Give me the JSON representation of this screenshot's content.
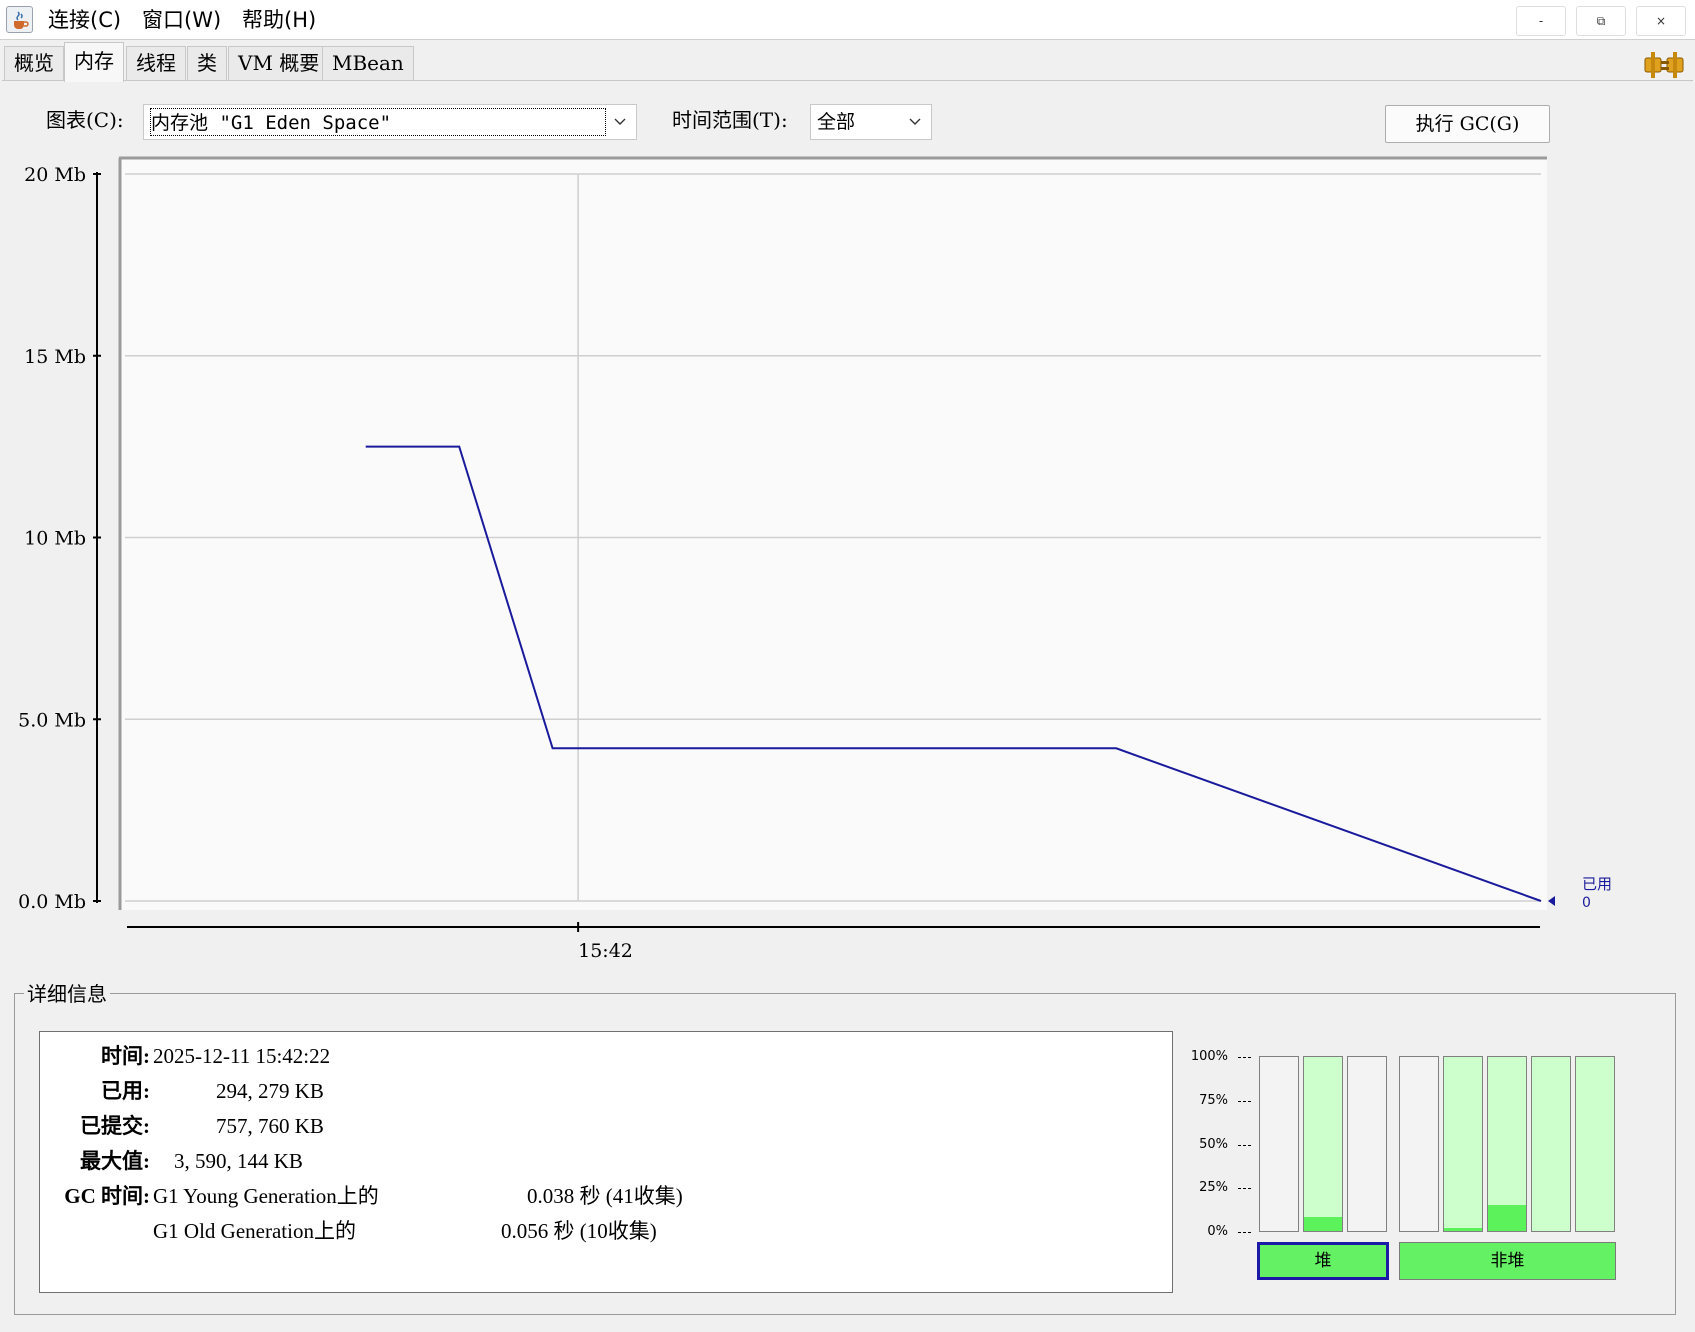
{
  "menu": [
    "连接(C)",
    "窗口(W)",
    "帮助(H)"
  ],
  "window_buttons": {
    "minimize": "-",
    "restore": "⧉",
    "close": "×"
  },
  "tabs": [
    {
      "label": "概览"
    },
    {
      "label": "内存",
      "active": true
    },
    {
      "label": "线程"
    },
    {
      "label": "类"
    },
    {
      "label": "VM 概要"
    },
    {
      "label": "MBean"
    }
  ],
  "controls": {
    "chart_label": "图表(C):",
    "chart_value": "内存池 \"G1 Eden Space\"",
    "range_label": "时间范围(T):",
    "range_value": "全部",
    "gc_button": "执行 GC(G)"
  },
  "chart_data": {
    "type": "line",
    "yticks": [
      "20 Mb",
      "15 Mb",
      "10 Mb",
      "5.0 Mb",
      "0.0 Mb"
    ],
    "ylim": [
      0,
      20
    ],
    "ytick_values": [
      20,
      15,
      10,
      5,
      0
    ],
    "xticks": [
      {
        "label": "15:42",
        "t": 0.32
      }
    ],
    "x_range": [
      0,
      1
    ],
    "series": [
      {
        "name": "已用",
        "color": "#1a1a9c",
        "points": [
          [
            0.17,
            12.5
          ],
          [
            0.236,
            12.5
          ],
          [
            0.302,
            4.2
          ],
          [
            0.7,
            4.2
          ],
          [
            1.0,
            0.0
          ]
        ]
      }
    ],
    "current_label": "已用",
    "current_value": "0",
    "grid": true
  },
  "details": {
    "legend": "详细信息",
    "time_label": "时间:",
    "time_value": "2025-12-11 15:42:22",
    "used_label": "已用:",
    "used_value": "294, 279 KB",
    "committed_label": "已提交:",
    "committed_value": "757, 760 KB",
    "max_label": "最大值:",
    "max_value": "3, 590, 144 KB",
    "gc_label": "GC 时间:",
    "gc_young_name": "G1 Young Generation上的",
    "gc_young_value": "0.038  秒 (41收集)",
    "gc_old_name": "G1 Old Generation上的",
    "gc_old_value": "0.056  秒 (10收集)"
  },
  "pct_labels": [
    "100%",
    "75%",
    "50%",
    "25%",
    "0%"
  ],
  "heap_bars": [
    {
      "committed": 0.0,
      "used": 0.0
    },
    {
      "committed": 1.0,
      "used": 0.08
    },
    {
      "committed": 0.0,
      "used": 0.0
    }
  ],
  "nonheap_bars": [
    {
      "committed": 0.0,
      "used": 0.0
    },
    {
      "committed": 1.0,
      "used": 0.02
    },
    {
      "committed": 1.0,
      "used": 0.15
    },
    {
      "committed": 1.0,
      "used": 0.0
    },
    {
      "committed": 1.0,
      "used": 0.0
    }
  ],
  "heap_button": "堆",
  "nonheap_button": "非堆"
}
